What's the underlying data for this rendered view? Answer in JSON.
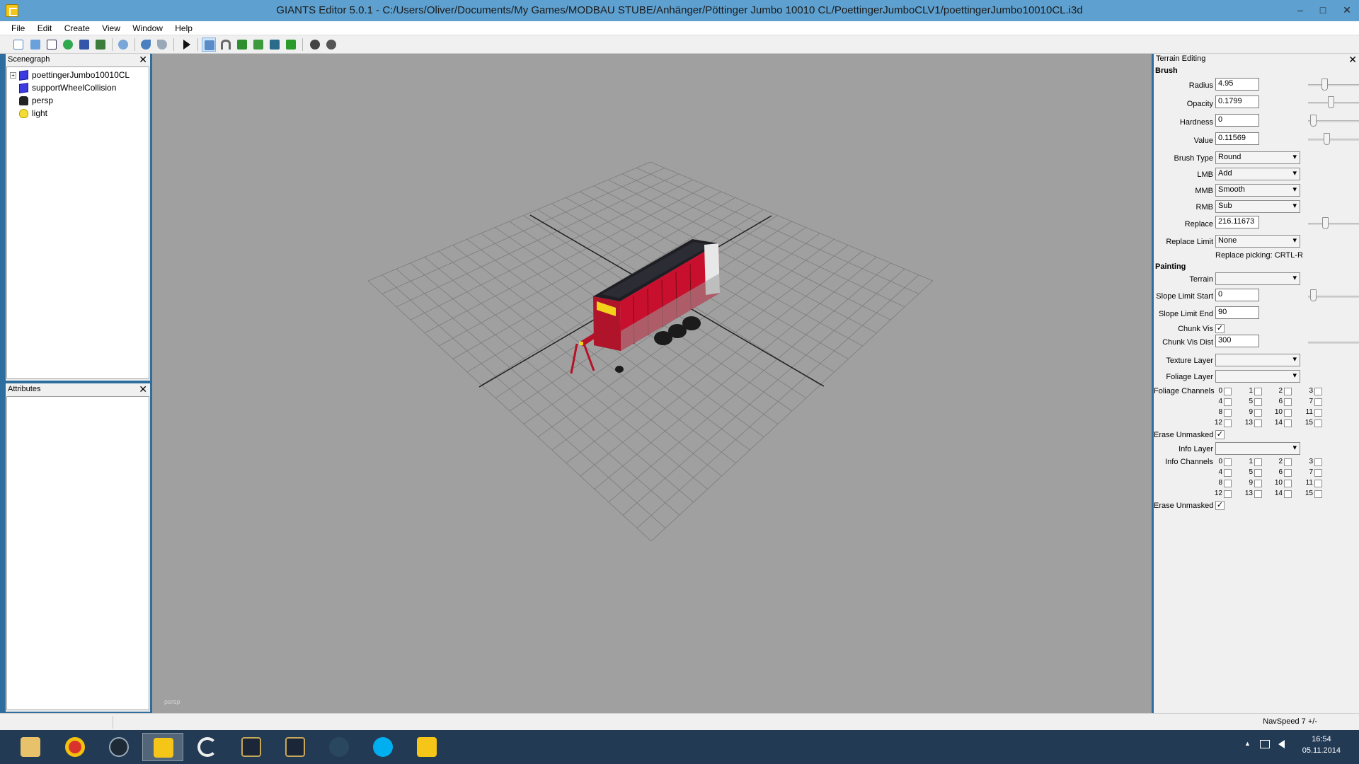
{
  "window": {
    "title": "GIANTS Editor 5.0.1 - C:/Users/Oliver/Documents/My Games/MODBAU STUBE/Anhänger/Pöttinger Jumbo 10010 CL/PoettingerJumboCLV1/poettingerJumbo10010CL.i3d",
    "minimize": "–",
    "maximize": "□",
    "close": "✕"
  },
  "menu": [
    "File",
    "Edit",
    "Create",
    "View",
    "Window",
    "Help"
  ],
  "toolbar": {
    "icons": [
      "new-icon",
      "open-icon",
      "list-icon",
      "refresh-icon",
      "save-icon",
      "save-all-icon",
      "import-icon",
      "undo-icon",
      "redo-icon",
      "play-icon",
      "select-icon",
      "magnet-icon",
      "terrain-sculpt-icon",
      "terrain-paint-icon",
      "foliage-icon",
      "grass-icon",
      "settings-icon",
      "settings-alt-icon"
    ]
  },
  "scenegraph": {
    "title": "Scenegraph",
    "close": "✕",
    "nodes": [
      {
        "label": "poettingerJumbo10010CL",
        "icon": "cube-icon",
        "expandable": true,
        "expander": "+"
      },
      {
        "label": "supportWheelCollision",
        "icon": "cube-icon",
        "expandable": false
      },
      {
        "label": "persp",
        "icon": "camera-icon",
        "expandable": false
      },
      {
        "label": "light",
        "icon": "light-bulb-icon",
        "expandable": false
      }
    ]
  },
  "attributes": {
    "title": "Attributes",
    "close": "✕"
  },
  "viewport": {
    "camera_label": "persp"
  },
  "terrain_editing": {
    "title": "Terrain Editing",
    "close": "✕",
    "brush_header": "Brush",
    "radius": {
      "label": "Radius",
      "value": "4.95",
      "slider": 0.3
    },
    "opacity": {
      "label": "Opacity",
      "value": "0.1799",
      "slider": 0.45
    },
    "hardness": {
      "label": "Hardness",
      "value": "0",
      "slider": 0.05
    },
    "value": {
      "label": "Value",
      "value": "0.11569",
      "slider": 0.35
    },
    "brush_type": {
      "label": "Brush Type",
      "value": "Round"
    },
    "lmb": {
      "label": "LMB",
      "value": "Add"
    },
    "mmb": {
      "label": "MMB",
      "value": "Smooth"
    },
    "rmb": {
      "label": "RMB",
      "value": "Sub"
    },
    "replace": {
      "label": "Replace",
      "value": "216.11673",
      "slider": 0.32
    },
    "replace_limit": {
      "label": "Replace Limit",
      "value": "None"
    },
    "replace_hint": "Replace picking: CRTL-R",
    "painting_header": "Painting",
    "terrain": {
      "label": "Terrain",
      "value": ""
    },
    "slope_start": {
      "label": "Slope Limit Start",
      "value": "0",
      "slider": 0.05
    },
    "slope_end": {
      "label": "Slope Limit End",
      "value": "90"
    },
    "chunk_vis": {
      "label": "Chunk Vis",
      "checked": true,
      "mark": "✓"
    },
    "chunk_vis_dist": {
      "label": "Chunk Vis Dist",
      "value": "300"
    },
    "texture_layer": {
      "label": "Texture Layer",
      "value": ""
    },
    "foliage_layer": {
      "label": "Foliage Layer",
      "value": ""
    },
    "foliage_channels": {
      "label": "Foliage Channels",
      "numbers": [
        "0",
        "1",
        "2",
        "3",
        "4",
        "5",
        "6",
        "7",
        "8",
        "9",
        "10",
        "11",
        "12",
        "13",
        "14",
        "15"
      ]
    },
    "erase_unmasked_1": {
      "label": "Erase Unmasked",
      "checked": true,
      "mark": "✓"
    },
    "info_layer": {
      "label": "Info Layer",
      "value": ""
    },
    "info_channels": {
      "label": "Info Channels",
      "numbers": [
        "0",
        "1",
        "2",
        "3",
        "4",
        "5",
        "6",
        "7",
        "8",
        "9",
        "10",
        "11",
        "12",
        "13",
        "14",
        "15"
      ]
    },
    "erase_unmasked_2": {
      "label": "Erase Unmasked",
      "checked": true,
      "mark": "✓"
    }
  },
  "statusbar": {
    "navspeed": "NavSpeed 7 +/-"
  },
  "taskbar": {
    "apps": [
      "file-explorer-icon",
      "chrome-icon",
      "steam-alt-icon",
      "giants-editor-icon",
      "logitech-g-icon",
      "league-icon",
      "league-icon",
      "steam-icon",
      "skype-icon",
      "giants-editor-icon"
    ],
    "active_index": 3,
    "tray_arrow": "▲",
    "tray_icons": [
      "network-icon",
      "volume-icon"
    ],
    "time": "16:54",
    "date": "05.11.2014"
  },
  "colors": {
    "titlebar": "#5ea0cf",
    "viewport": "#a0a0a0",
    "trailer_red": "#c8102e",
    "taskbar": "#223a54"
  }
}
